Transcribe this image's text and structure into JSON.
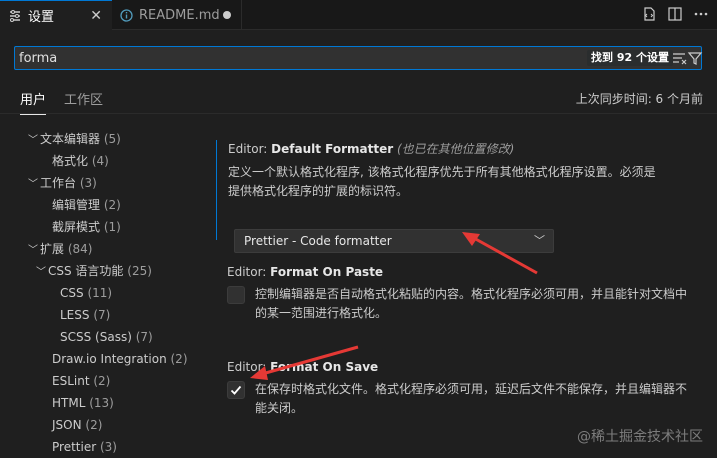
{
  "tabs": [
    {
      "label": "设置",
      "active": true
    },
    {
      "label": "README.md",
      "active": false,
      "modified": true
    }
  ],
  "search": {
    "value": "forma",
    "found_text": "找到 92 个设置"
  },
  "scopes": {
    "user": "用户",
    "workspace": "工作区",
    "sync": "上次同步时间: 6 个月前"
  },
  "tree": [
    {
      "label": "文本编辑器",
      "count": "(5)",
      "expanded": true,
      "level": 0
    },
    {
      "label": "格式化",
      "count": "(4)",
      "level": 1
    },
    {
      "label": "工作台",
      "count": "(3)",
      "expanded": true,
      "level": 0
    },
    {
      "label": "编辑管理",
      "count": "(2)",
      "level": 1
    },
    {
      "label": "截屏模式",
      "count": "(1)",
      "level": 1
    },
    {
      "label": "扩展",
      "count": "(84)",
      "expanded": true,
      "level": 0
    },
    {
      "label": "CSS 语言功能",
      "count": "(25)",
      "expanded": true,
      "level": 1
    },
    {
      "label": "CSS",
      "count": "(11)",
      "level": 2
    },
    {
      "label": "LESS",
      "count": "(7)",
      "level": 2
    },
    {
      "label": "SCSS (Sass)",
      "count": "(7)",
      "level": 2
    },
    {
      "label": "Draw.io Integration",
      "count": "(2)",
      "level": 1
    },
    {
      "label": "ESLint",
      "count": "(2)",
      "level": 1
    },
    {
      "label": "HTML",
      "count": "(13)",
      "level": 1
    },
    {
      "label": "JSON",
      "count": "(2)",
      "level": 1
    },
    {
      "label": "Prettier",
      "count": "(3)",
      "level": 1
    }
  ],
  "settings": {
    "default_formatter": {
      "category": "Editor: ",
      "name": "Default Formatter",
      "also": "(也已在其他位置修改)",
      "desc": "定义一个默认格式化程序, 该格式化程序优先于所有其他格式化程序设置。必须是提供格式化程序的扩展的标识符。",
      "value": "Prettier - Code formatter"
    },
    "format_on_paste": {
      "category": "Editor: ",
      "name": "Format On Paste",
      "desc": "控制编辑器是否自动格式化粘贴的内容。格式化程序必须可用，并且能针对文档中的某一范围进行格式化。",
      "checked": false
    },
    "format_on_save": {
      "category": "Editor: ",
      "name": "Format On Save",
      "desc": "在保存时格式化文件。格式化程序必须可用，延迟后文件不能保存，并且编辑器不能关闭。",
      "checked": true
    }
  },
  "watermark": "@稀土掘金技术社区",
  "colors": {
    "accent": "#0078d4",
    "arrow": "#e53935"
  }
}
